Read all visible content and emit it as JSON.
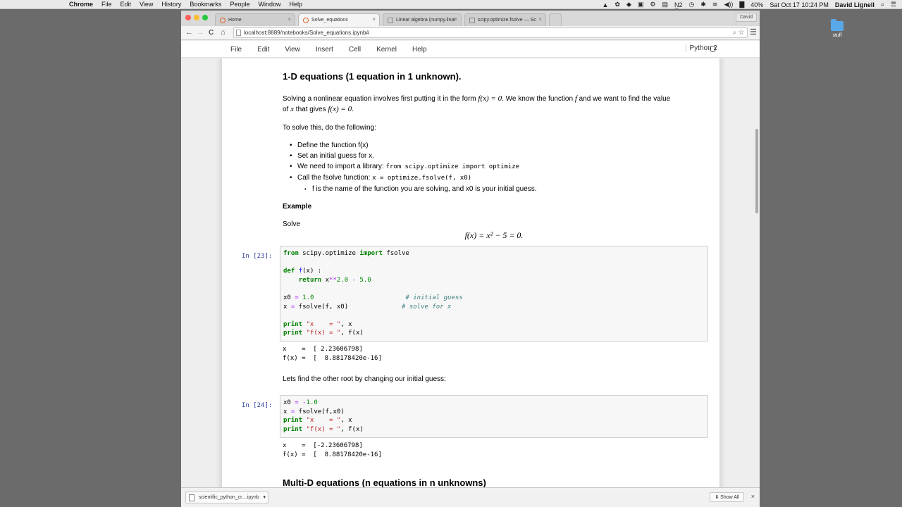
{
  "menubar": {
    "apple": "",
    "app": "Chrome",
    "items": [
      "File",
      "Edit",
      "View",
      "History",
      "Bookmarks",
      "People",
      "Window",
      "Help"
    ],
    "tray": [
      "▲",
      "✿",
      "◆",
      "▣",
      "⚙",
      "▤",
      "N̲2",
      "◷",
      "✱",
      "≋",
      "◀))",
      "▇",
      "40%"
    ],
    "battery": "40%",
    "datetime": "Sat Oct 17  10:24 PM",
    "user": "David Lignell"
  },
  "desktop": {
    "folder_label": "stuff"
  },
  "browser": {
    "tabs": [
      {
        "title": "Home"
      },
      {
        "title": "Solve_equations"
      },
      {
        "title": "Linear algebra (numpy.linal"
      },
      {
        "title": "scipy.optimize.fsolve — Sc"
      }
    ],
    "profile": "David",
    "url": "localhost:8889/notebooks/Solve_equations.ipynb#",
    "back": "←",
    "forward": "→",
    "reload": "C",
    "home": "⌂",
    "menu": "☰"
  },
  "jupyter": {
    "menu": [
      "File",
      "Edit",
      "View",
      "Insert",
      "Cell",
      "Kernel",
      "Help"
    ],
    "kernel": "Python 2"
  },
  "notebook": {
    "heading": "1-D equations (1 equation in 1 unknown).",
    "p1_a": "Solving a nonlinear equation involves first putting it in the form ",
    "p1_math1": "f(x) = 0",
    "p1_b": ". We know the function ",
    "p1_math2": "f",
    "p1_c": " and we want to find the value",
    "p1_d": "of ",
    "p1_math3": "x",
    "p1_e": " that gives ",
    "p1_math4": "f(x) = 0",
    "p1_f": ".",
    "p2": "To solve this, do the following:",
    "bullets": {
      "b1": "Define the function f(x)",
      "b2": "Set an initial guess for x.",
      "b3_text": "We need to import a library: ",
      "b3_code": "from scipy.optimize import optimize",
      "b4_text": "Call the fsolve function: ",
      "b4_code": "x = optimize.fsolve(f, x0)",
      "b5": "f is the name of the function you are solving, and x0 is your initial guess."
    },
    "example_label": "Example",
    "solve_label": "Solve",
    "equation": "f(x) = x² − 5 = 0.",
    "cell1": {
      "prompt": "In [23]:",
      "output": "x    =  [ 2.23606798]\nf(x) =  [  8.88178420e-16]"
    },
    "between_text": "Lets find the other root by changing our initial guess:",
    "cell2": {
      "prompt": "In [24]:",
      "output": "x    =  [-2.23606798]\nf(x) =  [  8.88178420e-16]"
    },
    "next_heading": "Multi-D equations (n equations in n unknowns)"
  },
  "downloads": {
    "file": "scientific_python_cr....ipynb",
    "show_all": "Show All"
  }
}
